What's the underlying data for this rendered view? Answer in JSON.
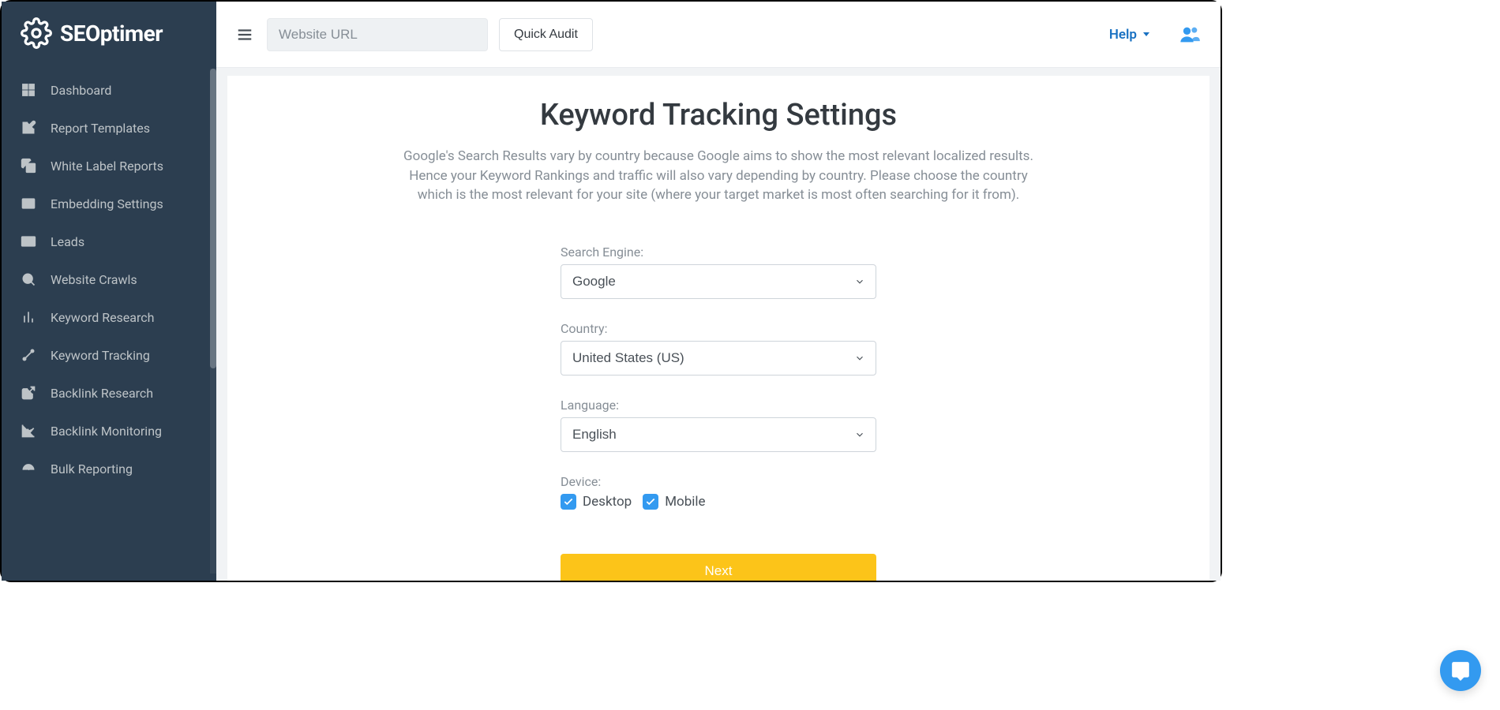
{
  "brand": {
    "name": "SEOptimer"
  },
  "sidebar": {
    "items": [
      {
        "label": "Dashboard"
      },
      {
        "label": "Report Templates"
      },
      {
        "label": "White Label Reports"
      },
      {
        "label": "Embedding Settings"
      },
      {
        "label": "Leads"
      },
      {
        "label": "Website Crawls"
      },
      {
        "label": "Keyword Research"
      },
      {
        "label": "Keyword Tracking"
      },
      {
        "label": "Backlink Research"
      },
      {
        "label": "Backlink Monitoring"
      },
      {
        "label": "Bulk Reporting"
      }
    ]
  },
  "topbar": {
    "url_placeholder": "Website URL",
    "audit_label": "Quick Audit",
    "help_label": "Help"
  },
  "page": {
    "title": "Keyword Tracking Settings",
    "description": "Google's Search Results vary by country because Google aims to show the most relevant localized results. Hence your Keyword Rankings and traffic will also vary depending by country. Please choose the country which is the most relevant for your site (where your target market is most often searching for it from).",
    "form": {
      "search_engine_label": "Search Engine:",
      "search_engine_value": "Google",
      "country_label": "Country:",
      "country_value": "United States (US)",
      "language_label": "Language:",
      "language_value": "English",
      "device_label": "Device:",
      "device_desktop": "Desktop",
      "device_mobile": "Mobile",
      "next_label": "Next"
    }
  }
}
